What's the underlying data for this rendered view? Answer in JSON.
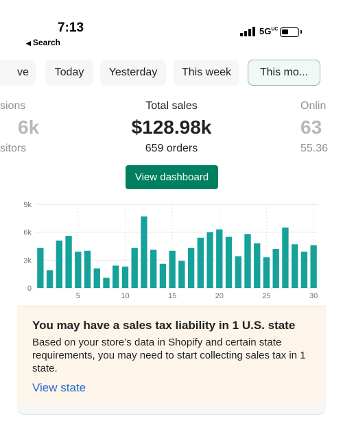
{
  "status_bar": {
    "time": "7:13",
    "back_label": "Search",
    "network": "5G",
    "network_sup": "UC"
  },
  "filters": [
    {
      "label": "ve",
      "active": false
    },
    {
      "label": "Today",
      "active": false
    },
    {
      "label": "Yesterday",
      "active": false
    },
    {
      "label": "This week",
      "active": false
    },
    {
      "label": "This mo...",
      "active": true
    }
  ],
  "metrics": {
    "left": {
      "label": "sions",
      "value": "6k",
      "sub": "sitors"
    },
    "center": {
      "label": "Total sales",
      "value": "$128.98k",
      "sub": "659 orders"
    },
    "right": {
      "label": "Onlin",
      "value": "63",
      "sub": "55.36"
    }
  },
  "dashboard_button": "View dashboard",
  "chart_data": {
    "type": "bar",
    "categories": [
      1,
      2,
      3,
      4,
      5,
      6,
      7,
      8,
      9,
      10,
      11,
      12,
      13,
      14,
      15,
      16,
      17,
      18,
      19,
      20,
      21,
      22,
      23,
      24,
      25,
      26,
      27,
      28,
      29,
      30
    ],
    "values": [
      4300,
      1900,
      5100,
      5600,
      3900,
      4000,
      2100,
      1100,
      2400,
      2300,
      4300,
      7700,
      4100,
      2600,
      4000,
      2900,
      4300,
      5400,
      6000,
      6300,
      5500,
      3400,
      5800,
      4800,
      3300,
      4200,
      6500,
      4700,
      3900,
      4600
    ],
    "y_ticks": [
      "0",
      "3k",
      "6k",
      "9k"
    ],
    "ylim": [
      0,
      9000
    ],
    "x_ticks": [
      {
        "day": 5,
        "label": "5"
      },
      {
        "day": 10,
        "label": "10"
      },
      {
        "day": 15,
        "label": "15"
      },
      {
        "day": 20,
        "label": "20"
      },
      {
        "day": 25,
        "label": "25"
      },
      {
        "day": 30,
        "label": "30"
      }
    ],
    "grid": true,
    "bar_color": "#16a29a"
  },
  "tax_card": {
    "title": "You may have a sales tax liability in 1 U.S. state",
    "body": "Based on your store’s data in Shopify and certain state requirements, you may need to start collecting sales tax in 1 state.",
    "link": "View state"
  },
  "colors": {
    "primary": "#008060",
    "link": "#2c6ecb",
    "card_bg": "#fdf4ea"
  }
}
